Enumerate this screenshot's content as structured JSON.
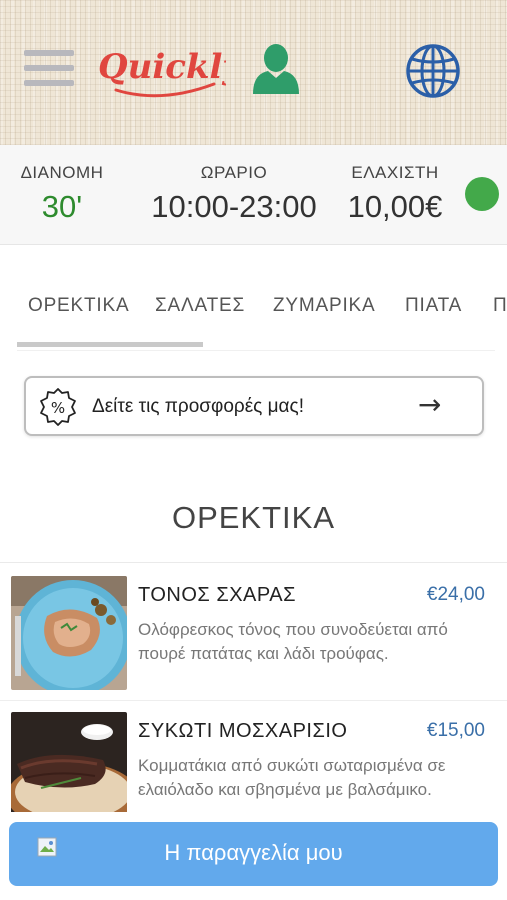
{
  "header": {
    "logo_text": "Quickly",
    "brand_color": "#e0463f",
    "user_icon": "user-icon",
    "globe_icon": "globe-icon",
    "menu_icon": "hamburger-menu-icon"
  },
  "info": {
    "delivery_label": "ΔΙΑΝΟΜΗ",
    "delivery_value": "30'",
    "hours_label": "ΩΡΑΡΙΟ",
    "hours_value": "10:00-23:00",
    "minimum_label": "ΕΛΑΧΙΣΤΗ",
    "minimum_value": "10,00€",
    "status_color": "#43a94a"
  },
  "tabs": [
    {
      "label": "ΟΡΕΚΤΙΚΑ",
      "active": true
    },
    {
      "label": "ΣΑΛΑΤΕΣ",
      "active": false
    },
    {
      "label": "ΖΥΜΑΡΙΚΑ",
      "active": false
    },
    {
      "label": "ΠΙΑΤΑ",
      "active": false
    },
    {
      "label": "Π",
      "active": false
    }
  ],
  "offers": {
    "text": "Δείτε τις προσφορές μας!",
    "icon": "discount-badge-icon",
    "arrow": "→"
  },
  "section": {
    "title": "ΟΡΕΚΤΙΚΑ"
  },
  "items": [
    {
      "name": "ΤΟΝΟΣ ΣΧΑΡΑΣ",
      "price": "€24,00",
      "description": "Ολόφρεσκος τόνος που συνοδεύεται από πουρέ πατάτας και λάδι τρούφας."
    },
    {
      "name": "ΣΥΚΩΤΙ ΜΟΣΧΑΡΙΣΙΟ",
      "price": "€15,00",
      "description": "Κομματάκια από συκώτι σωταρισμένα σε ελαιόλαδο και σβησμένα με βαλσάμικο."
    }
  ],
  "order_button": {
    "label": "Η παραγγελία μου",
    "color": "#62a9ec"
  }
}
